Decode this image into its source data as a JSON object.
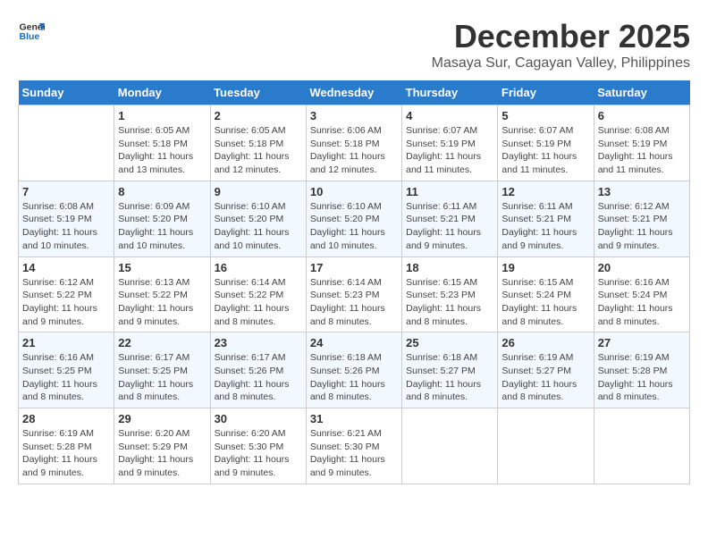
{
  "logo": {
    "text_general": "General",
    "text_blue": "Blue"
  },
  "header": {
    "month": "December 2025",
    "location": "Masaya Sur, Cagayan Valley, Philippines"
  },
  "weekdays": [
    "Sunday",
    "Monday",
    "Tuesday",
    "Wednesday",
    "Thursday",
    "Friday",
    "Saturday"
  ],
  "weeks": [
    [
      {
        "day": "",
        "sunrise": "",
        "sunset": "",
        "daylight": ""
      },
      {
        "day": "1",
        "sunrise": "Sunrise: 6:05 AM",
        "sunset": "Sunset: 5:18 PM",
        "daylight": "Daylight: 11 hours and 13 minutes."
      },
      {
        "day": "2",
        "sunrise": "Sunrise: 6:05 AM",
        "sunset": "Sunset: 5:18 PM",
        "daylight": "Daylight: 11 hours and 12 minutes."
      },
      {
        "day": "3",
        "sunrise": "Sunrise: 6:06 AM",
        "sunset": "Sunset: 5:18 PM",
        "daylight": "Daylight: 11 hours and 12 minutes."
      },
      {
        "day": "4",
        "sunrise": "Sunrise: 6:07 AM",
        "sunset": "Sunset: 5:19 PM",
        "daylight": "Daylight: 11 hours and 11 minutes."
      },
      {
        "day": "5",
        "sunrise": "Sunrise: 6:07 AM",
        "sunset": "Sunset: 5:19 PM",
        "daylight": "Daylight: 11 hours and 11 minutes."
      },
      {
        "day": "6",
        "sunrise": "Sunrise: 6:08 AM",
        "sunset": "Sunset: 5:19 PM",
        "daylight": "Daylight: 11 hours and 11 minutes."
      }
    ],
    [
      {
        "day": "7",
        "sunrise": "Sunrise: 6:08 AM",
        "sunset": "Sunset: 5:19 PM",
        "daylight": "Daylight: 11 hours and 10 minutes."
      },
      {
        "day": "8",
        "sunrise": "Sunrise: 6:09 AM",
        "sunset": "Sunset: 5:20 PM",
        "daylight": "Daylight: 11 hours and 10 minutes."
      },
      {
        "day": "9",
        "sunrise": "Sunrise: 6:10 AM",
        "sunset": "Sunset: 5:20 PM",
        "daylight": "Daylight: 11 hours and 10 minutes."
      },
      {
        "day": "10",
        "sunrise": "Sunrise: 6:10 AM",
        "sunset": "Sunset: 5:20 PM",
        "daylight": "Daylight: 11 hours and 10 minutes."
      },
      {
        "day": "11",
        "sunrise": "Sunrise: 6:11 AM",
        "sunset": "Sunset: 5:21 PM",
        "daylight": "Daylight: 11 hours and 9 minutes."
      },
      {
        "day": "12",
        "sunrise": "Sunrise: 6:11 AM",
        "sunset": "Sunset: 5:21 PM",
        "daylight": "Daylight: 11 hours and 9 minutes."
      },
      {
        "day": "13",
        "sunrise": "Sunrise: 6:12 AM",
        "sunset": "Sunset: 5:21 PM",
        "daylight": "Daylight: 11 hours and 9 minutes."
      }
    ],
    [
      {
        "day": "14",
        "sunrise": "Sunrise: 6:12 AM",
        "sunset": "Sunset: 5:22 PM",
        "daylight": "Daylight: 11 hours and 9 minutes."
      },
      {
        "day": "15",
        "sunrise": "Sunrise: 6:13 AM",
        "sunset": "Sunset: 5:22 PM",
        "daylight": "Daylight: 11 hours and 9 minutes."
      },
      {
        "day": "16",
        "sunrise": "Sunrise: 6:14 AM",
        "sunset": "Sunset: 5:22 PM",
        "daylight": "Daylight: 11 hours and 8 minutes."
      },
      {
        "day": "17",
        "sunrise": "Sunrise: 6:14 AM",
        "sunset": "Sunset: 5:23 PM",
        "daylight": "Daylight: 11 hours and 8 minutes."
      },
      {
        "day": "18",
        "sunrise": "Sunrise: 6:15 AM",
        "sunset": "Sunset: 5:23 PM",
        "daylight": "Daylight: 11 hours and 8 minutes."
      },
      {
        "day": "19",
        "sunrise": "Sunrise: 6:15 AM",
        "sunset": "Sunset: 5:24 PM",
        "daylight": "Daylight: 11 hours and 8 minutes."
      },
      {
        "day": "20",
        "sunrise": "Sunrise: 6:16 AM",
        "sunset": "Sunset: 5:24 PM",
        "daylight": "Daylight: 11 hours and 8 minutes."
      }
    ],
    [
      {
        "day": "21",
        "sunrise": "Sunrise: 6:16 AM",
        "sunset": "Sunset: 5:25 PM",
        "daylight": "Daylight: 11 hours and 8 minutes."
      },
      {
        "day": "22",
        "sunrise": "Sunrise: 6:17 AM",
        "sunset": "Sunset: 5:25 PM",
        "daylight": "Daylight: 11 hours and 8 minutes."
      },
      {
        "day": "23",
        "sunrise": "Sunrise: 6:17 AM",
        "sunset": "Sunset: 5:26 PM",
        "daylight": "Daylight: 11 hours and 8 minutes."
      },
      {
        "day": "24",
        "sunrise": "Sunrise: 6:18 AM",
        "sunset": "Sunset: 5:26 PM",
        "daylight": "Daylight: 11 hours and 8 minutes."
      },
      {
        "day": "25",
        "sunrise": "Sunrise: 6:18 AM",
        "sunset": "Sunset: 5:27 PM",
        "daylight": "Daylight: 11 hours and 8 minutes."
      },
      {
        "day": "26",
        "sunrise": "Sunrise: 6:19 AM",
        "sunset": "Sunset: 5:27 PM",
        "daylight": "Daylight: 11 hours and 8 minutes."
      },
      {
        "day": "27",
        "sunrise": "Sunrise: 6:19 AM",
        "sunset": "Sunset: 5:28 PM",
        "daylight": "Daylight: 11 hours and 8 minutes."
      }
    ],
    [
      {
        "day": "28",
        "sunrise": "Sunrise: 6:19 AM",
        "sunset": "Sunset: 5:28 PM",
        "daylight": "Daylight: 11 hours and 9 minutes."
      },
      {
        "day": "29",
        "sunrise": "Sunrise: 6:20 AM",
        "sunset": "Sunset: 5:29 PM",
        "daylight": "Daylight: 11 hours and 9 minutes."
      },
      {
        "day": "30",
        "sunrise": "Sunrise: 6:20 AM",
        "sunset": "Sunset: 5:30 PM",
        "daylight": "Daylight: 11 hours and 9 minutes."
      },
      {
        "day": "31",
        "sunrise": "Sunrise: 6:21 AM",
        "sunset": "Sunset: 5:30 PM",
        "daylight": "Daylight: 11 hours and 9 minutes."
      },
      {
        "day": "",
        "sunrise": "",
        "sunset": "",
        "daylight": ""
      },
      {
        "day": "",
        "sunrise": "",
        "sunset": "",
        "daylight": ""
      },
      {
        "day": "",
        "sunrise": "",
        "sunset": "",
        "daylight": ""
      }
    ]
  ]
}
